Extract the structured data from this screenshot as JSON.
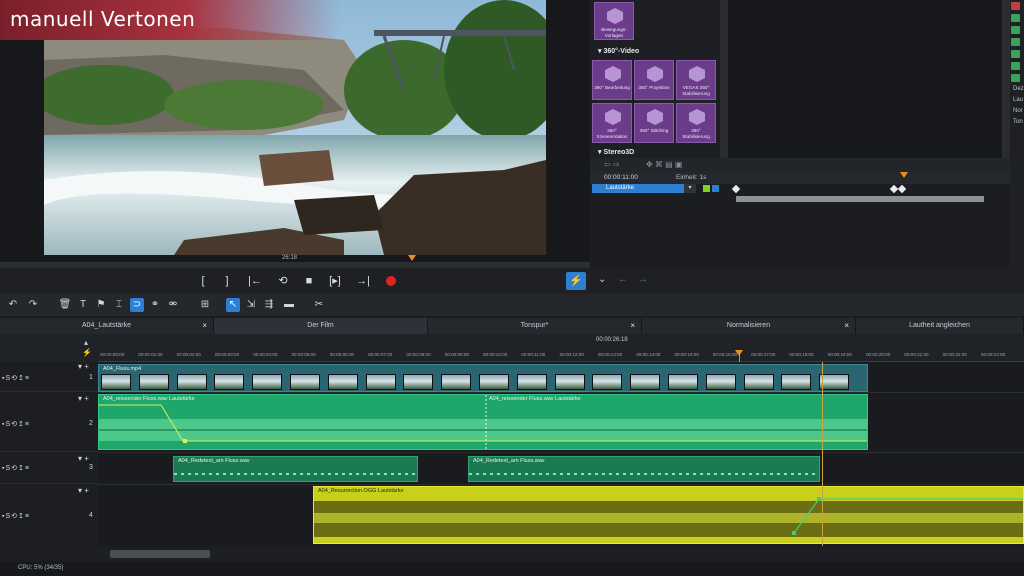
{
  "logo": {
    "text": "manuell Vertonen"
  },
  "preview": {
    "timecode": "26:18"
  },
  "transport": {
    "in_point": "[",
    "out_point": "]",
    "prev_marker": "|←",
    "loop": "⟲",
    "stop": "■",
    "next_frame": "[▸]",
    "next_marker": "→|",
    "split": "⚡"
  },
  "effects": {
    "top_tile_label": "Bewegungs-Vorlagen",
    "section_360": "360°-Video",
    "tiles": [
      {
        "label": "360° Bearbeitung"
      },
      {
        "label": "360° Projektion"
      },
      {
        "label": "VEGAS 360° Stabilisierung"
      },
      {
        "label": "360° Szenenrotation"
      },
      {
        "label": "360° Stitching"
      },
      {
        "label": "360° Stabilisierung"
      }
    ],
    "section_stereo": "Stereo3D"
  },
  "side_panel": {
    "lines": [
      "Dez",
      "Lau",
      "Nor",
      "Ton"
    ]
  },
  "keyframe": {
    "timecode": "00:00:11:00",
    "unit_label": "Einheit: 1s",
    "parameter": "Lautstärke"
  },
  "tabs": [
    {
      "label": "A04_Lautstärke"
    },
    {
      "label": "Der Film"
    },
    {
      "label": "Tonspur*"
    },
    {
      "label": "Normalisieren"
    },
    {
      "label": "Lautheit angleichen"
    }
  ],
  "ruler": {
    "center_timecode": "00:00:26:18",
    "ticks": [
      "00:00:00:00",
      "00:00:01:00",
      "00:00:02:00",
      "00:00:03:00",
      "00:00:04:00",
      "00:00:05:00",
      "00:00:06:00",
      "00:00:07:00",
      "00:00:08:00",
      "00:00:09:00",
      "00:00:10:00",
      "00:00:11:00",
      "00:00:12:00",
      "00:00:13:00",
      "00:00:14:00",
      "00:00:15:00",
      "00:00:16:00",
      "00:00:17:00",
      "00:00:18:00",
      "00:00:19:00",
      "00:00:20:00",
      "00:00:21:00",
      "00:00:22:00",
      "00:00:23:00"
    ]
  },
  "tracks": [
    {
      "number": "1",
      "controls": "▪S⟲↥≡"
    },
    {
      "number": "2",
      "controls": "▪S⟲↥≡"
    },
    {
      "number": "3",
      "controls": "▪S⟲↥≡"
    },
    {
      "number": "4",
      "controls": "▪S⟲↥≡"
    }
  ],
  "clips": {
    "video": "A04_Fluss.mp4",
    "audio1": "A04_reissender Fluss.wav   Lautstärke",
    "audio1b": "A04_reissender Fluss.wav   Lautstärke",
    "speech1": "A04_Redetext_am Fluss.wav",
    "speech2": "A04_Redetext_am Fluss.wav",
    "music": "A04_Resurrection.OGG   Lautstärke"
  },
  "status": {
    "cpu": "CPU: 5% (34/35)"
  },
  "colors": {
    "accent": "#2d7fd1",
    "playhead": "#f0901a",
    "video_clip": "#2a6672",
    "audio_clip": "#1fa66a",
    "music_clip": "#c8d01c",
    "fx_tile": "#6a3c8a"
  }
}
